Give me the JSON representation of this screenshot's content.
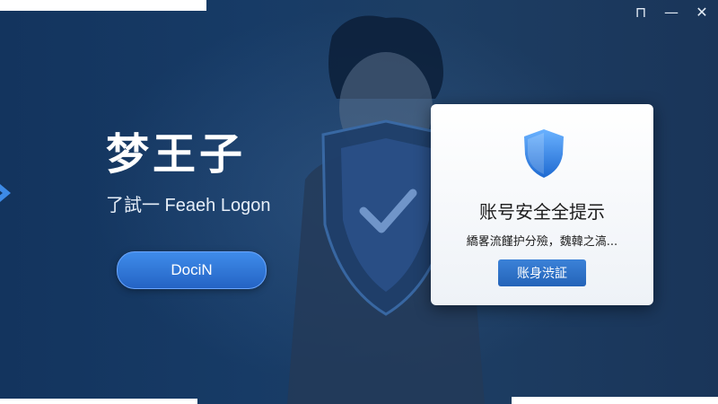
{
  "window": {
    "controls": {
      "pin": "⊓",
      "minimize": "—",
      "close": "✕"
    }
  },
  "brand": {
    "title": "梦王子",
    "subtitle": "了試一 Feaeh Logon"
  },
  "login_button": {
    "label": "DociN"
  },
  "dialog": {
    "icon": "shield-check-icon",
    "title": "账号安全全提示",
    "message": "繑畧流饉护分殮，魏韓之滈...",
    "verify_button": "账身渋証"
  },
  "colors": {
    "accent": "#2f74d6",
    "background": "#163a64"
  }
}
